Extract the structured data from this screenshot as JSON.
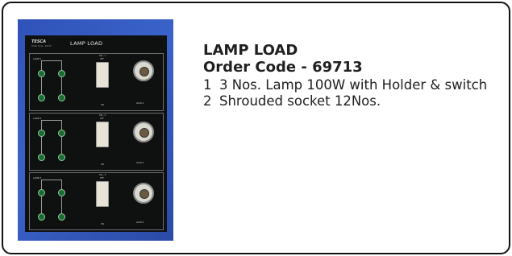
{
  "product": {
    "title": "LAMP LOAD",
    "order_code": "Order Code - 69713",
    "items": [
      {
        "num": "1",
        "text": "3 Nos. Lamp 100W with Holder & switch"
      },
      {
        "num": "2",
        "text": "Shrouded socket 12Nos."
      }
    ]
  },
  "panel": {
    "logo": "TESCA",
    "subtitle": "Order Code - 69713",
    "title": "LAMP LOAD",
    "sections": [
      {
        "label": "LAMP-1",
        "switch": "SW - 1",
        "off": "OFF",
        "on": "ON",
        "lamp": "LOAD-1"
      },
      {
        "label": "LAMP-2",
        "switch": "SW - 2",
        "off": "OFF",
        "on": "ON",
        "lamp": "LOAD-2"
      },
      {
        "label": "LAMP-3",
        "switch": "SW - 3",
        "off": "OFF",
        "on": "ON",
        "lamp": "LOAD-3"
      }
    ]
  },
  "colors": {
    "panel_bg": "#0f1010",
    "backdrop": "#3a63c9",
    "socket": "#1b6a35",
    "text": "#202020"
  }
}
